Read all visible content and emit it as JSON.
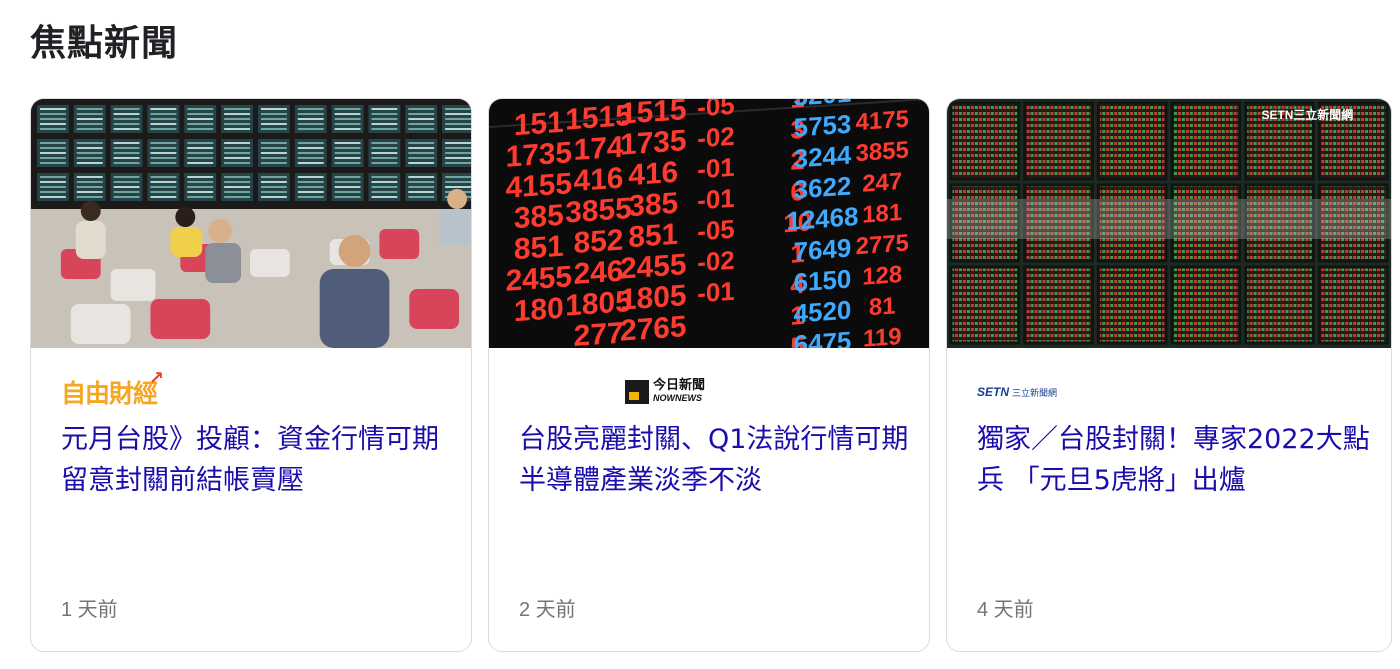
{
  "section": {
    "title": "焦點新聞"
  },
  "cards": [
    {
      "source": "自由財經",
      "source_icon": "ltn-finance-logo",
      "headline": "元月台股》投顧：資金行情可期 留意封關前結帳賣壓",
      "age": "1 天前"
    },
    {
      "source": "今日新聞 NOWnews",
      "source_icon": "nownews-logo",
      "headline": "台股亮麗封關、Q1法說行情可期 半導體產業淡季不淡",
      "age": "2 天前"
    },
    {
      "source": "SETN 三立新聞網",
      "source_icon": "setn-logo",
      "headline": "獨家／台股封關！專家2022大點兵 「元旦5虎將」出爐",
      "age": "4 天前"
    }
  ],
  "thumb_board": {
    "cols": [
      [
        "151",
        "1735",
        "4155",
        "385",
        "851",
        "2455",
        "180"
      ],
      [
        "1515",
        "174",
        "416",
        "3855",
        "852",
        "246",
        "1805",
        "277"
      ],
      [
        "1515",
        "1735",
        "416",
        "385",
        "851",
        "2455",
        "1805",
        "2765"
      ],
      [
        "-05",
        "-02",
        "-01",
        "-01",
        "-05",
        "-02",
        "-01"
      ],
      [
        "1",
        "3",
        "2",
        "6",
        "10",
        "1",
        "4",
        "1",
        "5"
      ],
      [
        "3201",
        "5753",
        "3244",
        "3622",
        "12468",
        "7649",
        "6150",
        "4520",
        "6475"
      ],
      [
        "174",
        "4175",
        "3855",
        "247",
        "181",
        "2775",
        "128",
        "81",
        "119"
      ]
    ],
    "watermark": "SETN三立新聞網"
  },
  "colors": {
    "link": "#1a0dab",
    "muted": "#70757a",
    "border": "#dadce0"
  }
}
